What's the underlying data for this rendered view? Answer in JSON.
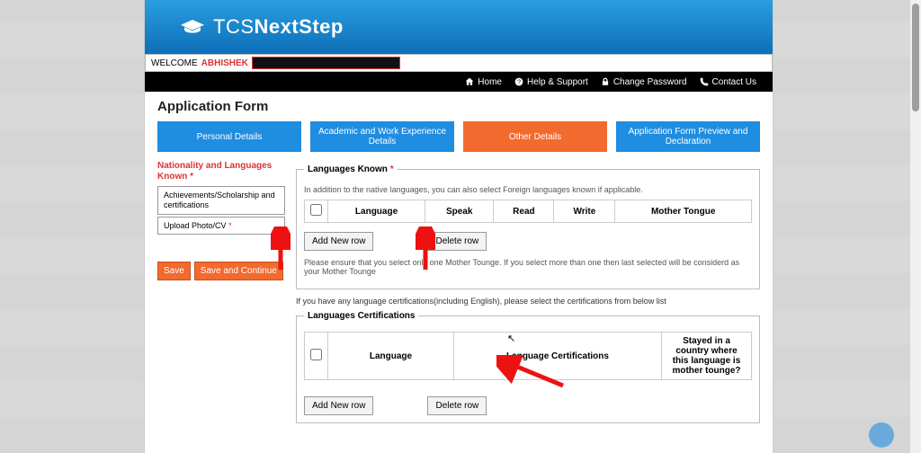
{
  "brand": {
    "prefix": "TCS",
    "suffix": "NextStep"
  },
  "welcome": {
    "label": "WELCOME",
    "name": "ABHISHEK"
  },
  "topnav": {
    "home": "Home",
    "help": "Help & Support",
    "password": "Change Password",
    "contact": "Contact Us"
  },
  "page_title": "Application Form",
  "tabs": {
    "t1": "Personal Details",
    "t2": "Academic and Work Experience Details",
    "t3": "Other Details",
    "t4": "Application Form Preview and Declaration"
  },
  "sidebar": {
    "head": "Nationality and Languages Known",
    "item2": "Achievements/Scholarship and certifications",
    "item3": "Upload Photo/CV"
  },
  "buttons": {
    "save": "Save",
    "save_continue": "Save and Continue"
  },
  "lang_box": {
    "legend": "Languages Known",
    "helper": "In addition to the native languages, you can also select Foreign languages known if applicable.",
    "cols": {
      "language": "Language",
      "speak": "Speak",
      "read": "Read",
      "write": "Write",
      "mother": "Mother Tongue"
    },
    "add": "Add New row",
    "del": "Delete row",
    "foot_note": "Please ensure that you select only one Mother Tounge. If you select more than one then last selected will be considerd as your Mother Tounge"
  },
  "cert_intro": "If you have any language certifications(including English), please select the certifications from below list",
  "cert_box": {
    "legend": "Languages Certifications",
    "cols": {
      "language": "Language",
      "cert": "Language Certifications",
      "stay": "Stayed in a country where this language is mother tounge?"
    },
    "add": "Add New row",
    "del": "Delete row"
  }
}
